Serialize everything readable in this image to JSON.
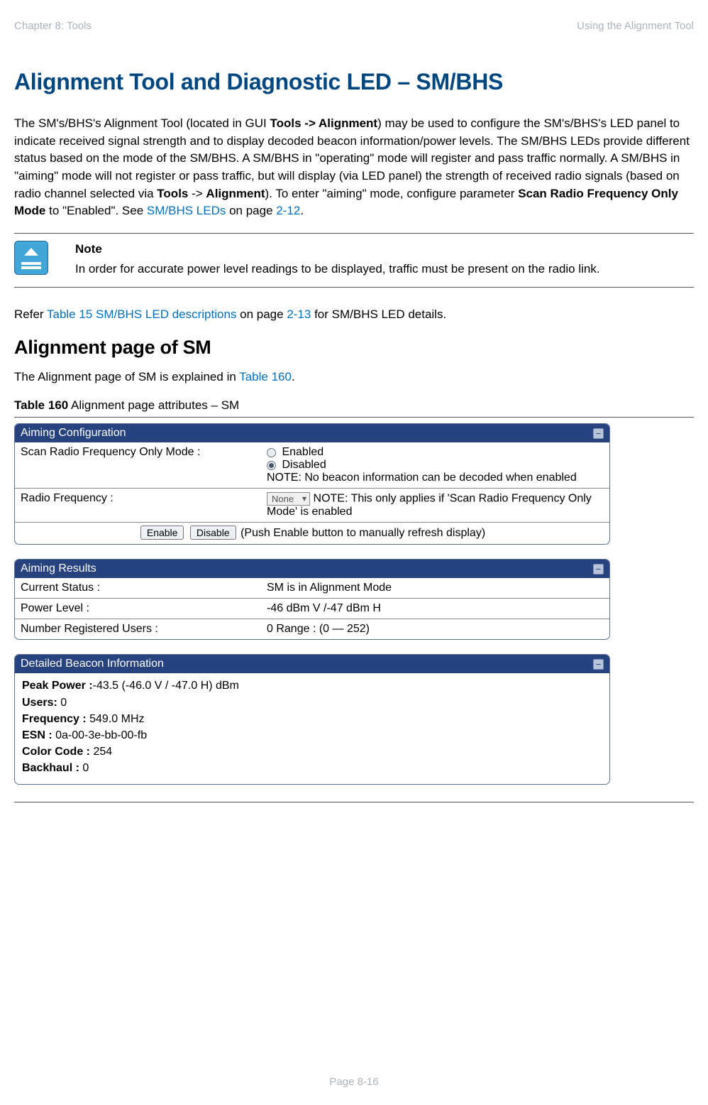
{
  "header": {
    "left": "Chapter 8:  Tools",
    "right": "Using the Alignment Tool"
  },
  "h1": "Alignment Tool and Diagnostic LED – SM/BHS",
  "para1": {
    "a": "The SM's/BHS's Alignment Tool (located in GUI ",
    "b": "Tools -> Alignment",
    "c": ") may be used to configure the SM's/BHS's LED panel to indicate received signal strength and to display decoded beacon information/power levels. The SM/BHS LEDs provide different status based on the mode of the SM/BHS. A SM/BHS in \"operating\" mode will register and pass traffic normally. A SM/BHS in \"aiming\" mode will not register or pass traffic, but will display (via LED panel) the strength of received radio signals (based on radio channel selected via ",
    "d": "Tools",
    "e": " -> ",
    "f": "Alignment",
    "g": "). To enter \"aiming\" mode, configure parameter ",
    "h": "Scan Radio Frequency Only Mode",
    "i": " to \"Enabled\". See ",
    "j": "SM/BHS LEDs",
    "k": " on page ",
    "l": "2-12",
    "m": "."
  },
  "note": {
    "heading": "Note",
    "body": "In order for accurate power level readings to be displayed, traffic must be present on the radio link."
  },
  "para2": {
    "a": "Refer ",
    "b": "Table 15 SM/BHS LED descriptions",
    "c": " on page ",
    "d": "2-13",
    "e": " for SM/BHS LED details."
  },
  "h2": "Alignment page of SM",
  "para3": {
    "a": "The Alignment page of SM is explained in ",
    "b": "Table 160",
    "c": "."
  },
  "caption": {
    "b": "Table 160",
    "text": " Alignment page attributes – SM"
  },
  "fig": {
    "panel1": {
      "title": "Aiming Configuration",
      "row1": {
        "label": "Scan Radio Frequency Only Mode :",
        "opt1": "Enabled",
        "opt2": "Disabled",
        "note": "NOTE: No beacon information can be decoded when enabled"
      },
      "row2": {
        "label": "Radio Frequency :",
        "select": "None",
        "note": " NOTE: This only applies if 'Scan Radio Frequency Only Mode' is enabled"
      },
      "buttons": {
        "enable": "Enable",
        "disable": "Disable",
        "hint": " (Push Enable button to manually refresh display)"
      }
    },
    "panel2": {
      "title": "Aiming Results",
      "rows": [
        {
          "label": "Current Status :",
          "value": "SM is in Alignment Mode"
        },
        {
          "label": "Power Level :",
          "value": "-46 dBm V /-47 dBm H"
        },
        {
          "label": "Number Registered Users :",
          "value": "0 Range : (0 — 252)"
        }
      ]
    },
    "panel3": {
      "title": "Detailed Beacon Information",
      "lines": [
        {
          "k": "Peak Power :",
          "v": "-43.5 (-46.0 V / -47.0 H) dBm"
        },
        {
          "k": "Users:",
          "v": " 0"
        },
        {
          "k": "Frequency :",
          "v": " 549.0 MHz"
        },
        {
          "k": "ESN :",
          "v": " 0a-00-3e-bb-00-fb"
        },
        {
          "k": "Color Code :",
          "v": " 254"
        },
        {
          "k": "Backhaul :",
          "v": " 0"
        }
      ]
    }
  },
  "pagenum": "Page 8-16"
}
